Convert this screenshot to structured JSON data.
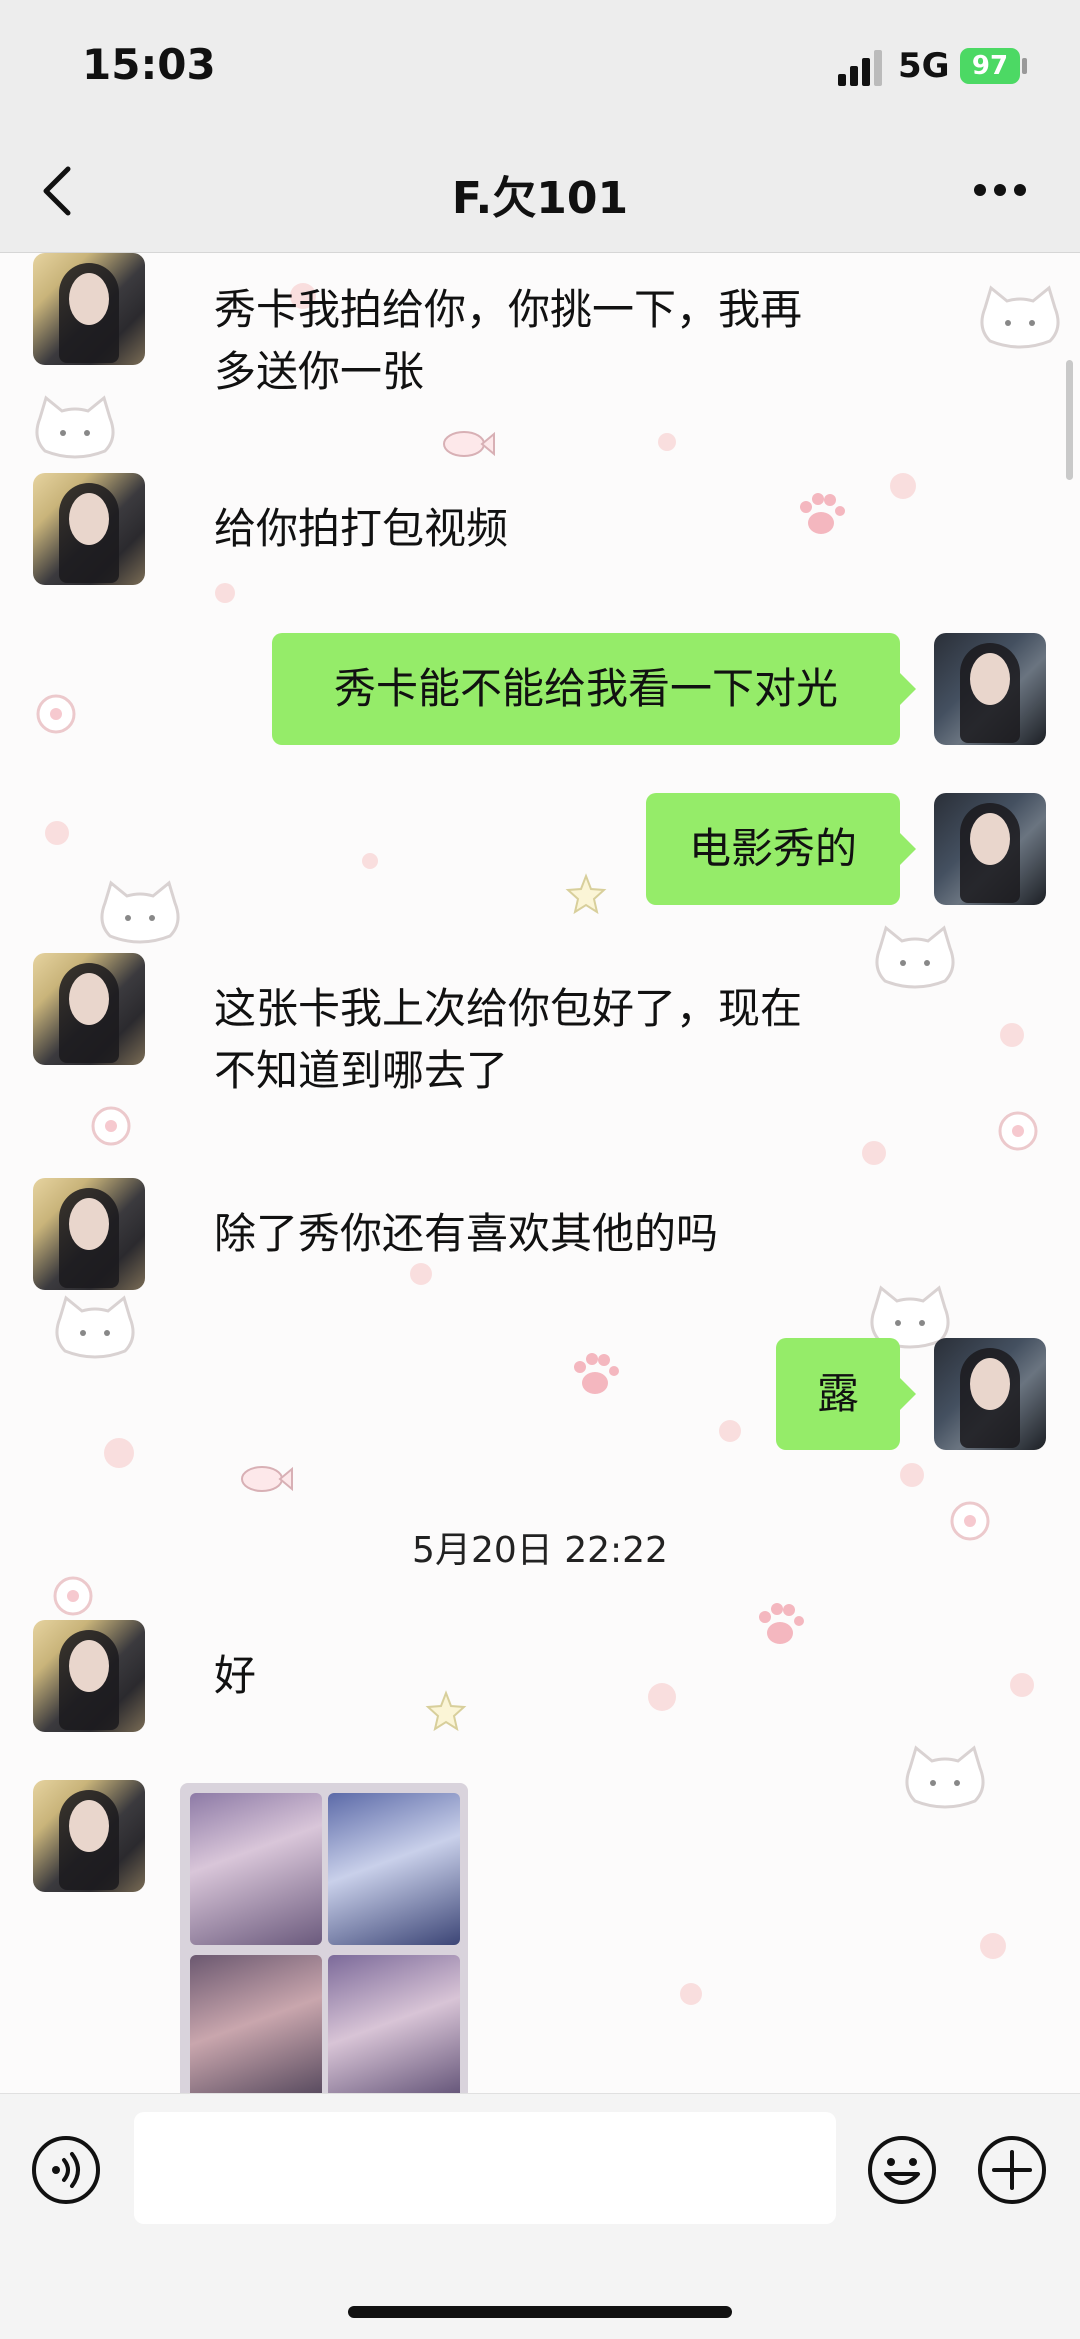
{
  "status_bar": {
    "time": "15:03",
    "network": "5G",
    "battery": "97"
  },
  "header": {
    "title": "F.欠101",
    "back_icon": "chevron-left-icon",
    "more_icon": "more-dots-icon"
  },
  "messages": [
    {
      "from": "friend",
      "text_lines": [
        "秀卡我拍给你，你挑一下，我再",
        "多送你一张"
      ]
    },
    {
      "from": "friend",
      "text_lines": [
        "给你拍打包视频"
      ]
    },
    {
      "from": "me",
      "text": "秀卡能不能给我看一下对光"
    },
    {
      "from": "me",
      "text": "电影秀的"
    },
    {
      "from": "friend",
      "text_lines": [
        "这张卡我上次给你包好了，现在",
        "不知道到哪去了"
      ]
    },
    {
      "from": "friend",
      "text_lines": [
        "除了秀你还有喜欢其他的吗"
      ]
    },
    {
      "from": "me",
      "text": "露"
    },
    {
      "from": "friend",
      "text_lines": [
        "好"
      ]
    },
    {
      "from": "friend",
      "type": "image"
    }
  ],
  "timestamp": "5月20日 22:22",
  "input_bar": {
    "placeholder": "",
    "voice_icon": "voice-icon",
    "emoji_icon": "emoji-icon",
    "plus_icon": "plus-icon"
  },
  "colors": {
    "sent_bubble": "#95ec69",
    "header_bg": "#ededed"
  }
}
